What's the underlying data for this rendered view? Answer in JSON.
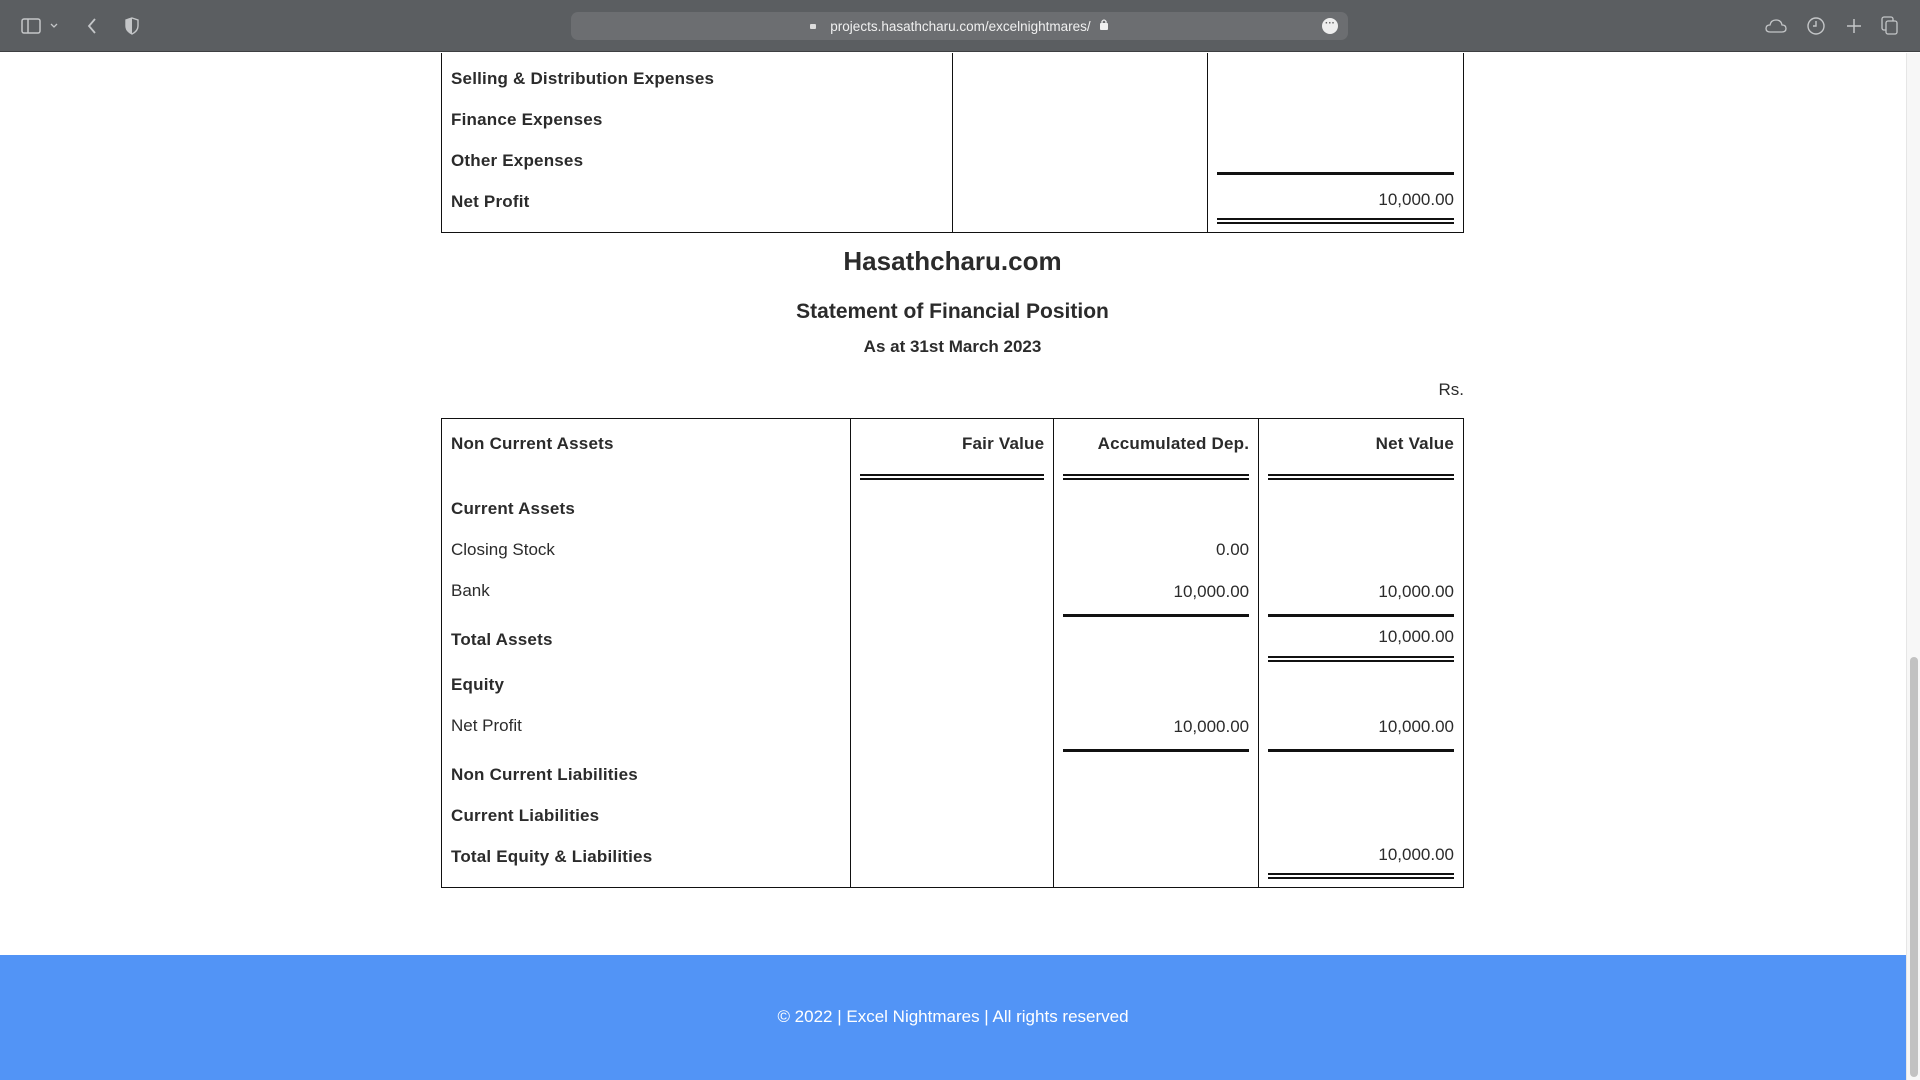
{
  "browser": {
    "url": "projects.hasathcharu.com/excelnightmares/",
    "icons": [
      "sidebar-icon",
      "chevron-down-icon",
      "back-icon",
      "shield-icon",
      "more-icon",
      "cloud-icon",
      "history-icon",
      "new-tab-icon",
      "tabs-overview-icon"
    ]
  },
  "income_statement_tail": {
    "rows": [
      {
        "label": "Selling & Distribution Expenses",
        "col2": "",
        "col3": ""
      },
      {
        "label": "Finance Expenses",
        "col2": "",
        "col3": ""
      },
      {
        "label": "Other Expenses",
        "col2": "",
        "col3": ""
      },
      {
        "label": "Net Profit",
        "col2": "",
        "col3": "10,000.00"
      }
    ]
  },
  "sofp": {
    "company": "Hasathcharu.com",
    "title": "Statement of Financial Position",
    "date": "As at 31st March 2023",
    "currency": "Rs.",
    "columns": [
      "Non Current Assets",
      "Fair Value",
      "Accumulated Dep.",
      "Net Value"
    ],
    "rows": [
      {
        "label": "Current Assets",
        "bold": true,
        "fair": "",
        "acc": "",
        "net": ""
      },
      {
        "label": "Closing Stock",
        "bold": false,
        "fair": "",
        "acc": "0.00",
        "net": ""
      },
      {
        "label": "Bank",
        "bold": false,
        "fair": "",
        "acc": "10,000.00",
        "net": "10,000.00"
      },
      {
        "label": "Total Assets",
        "bold": true,
        "fair": "",
        "acc": "",
        "net": "10,000.00"
      },
      {
        "label": "Equity",
        "bold": true,
        "fair": "",
        "acc": "",
        "net": ""
      },
      {
        "label": "Net Profit",
        "bold": false,
        "fair": "",
        "acc": "10,000.00",
        "net": "10,000.00"
      },
      {
        "label": "Non Current Liabilities",
        "bold": true,
        "fair": "",
        "acc": "",
        "net": ""
      },
      {
        "label": "Current Liabilities",
        "bold": true,
        "fair": "",
        "acc": "",
        "net": ""
      },
      {
        "label": "Total Equity & Liabilities",
        "bold": true,
        "fair": "",
        "acc": "",
        "net": "10,000.00"
      }
    ]
  },
  "footer": {
    "text": "© 2022 | Excel Nightmares | All rights reserved",
    "color": "#5294f6"
  }
}
